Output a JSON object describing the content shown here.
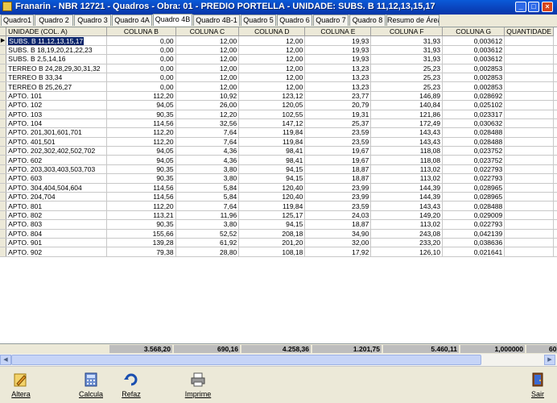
{
  "window": {
    "title": "Franarin - NBR 12721 - Quadros - Obra: 01 - PREDIO PORTELLA - UNIDADE: SUBS. B 11,12,13,15,17",
    "minimize": "_",
    "maximize": "□",
    "close": "×"
  },
  "tabs": [
    "Quadro1",
    "Quadro 2",
    "Quadro 3",
    "Quadro 4A",
    "Quadro 4B",
    "Quadro 4B-1",
    "Quadro 5",
    "Quadro 6",
    "Quadro 7",
    "Quadro 8",
    "Resumo de Áreas"
  ],
  "active_tab": "Quadro 4B",
  "grid": {
    "columns": [
      "UNIDADE (COL. A)",
      "COLUNA B",
      "COLUNA C",
      "COLUNA D",
      "COLUNA E",
      "COLUNA F",
      "COLUNA G",
      "QUANTIDADE"
    ],
    "rows": [
      [
        "SUBS. B 11,12,13,15,17",
        "0,00",
        "12,00",
        "12,00",
        "19,93",
        "31,93",
        "0,003612",
        ""
      ],
      [
        "SUBS. B 18,19,20,21,22,23",
        "0,00",
        "12,00",
        "12,00",
        "19,93",
        "31,93",
        "0,003612",
        ""
      ],
      [
        "SUBS. B 2,5,14,16",
        "0,00",
        "12,00",
        "12,00",
        "19,93",
        "31,93",
        "0,003612",
        ""
      ],
      [
        "TERREO B 24,28,29,30,31,32",
        "0,00",
        "12,00",
        "12,00",
        "13,23",
        "25,23",
        "0,002853",
        ""
      ],
      [
        "TERREO B 33,34",
        "0,00",
        "12,00",
        "12,00",
        "13,23",
        "25,23",
        "0,002853",
        ""
      ],
      [
        "TERREO B 25,26,27",
        "0,00",
        "12,00",
        "12,00",
        "13,23",
        "25,23",
        "0,002853",
        ""
      ],
      [
        "APTO. 101",
        "112,20",
        "10,92",
        "123,12",
        "23,77",
        "146,89",
        "0,028692",
        ""
      ],
      [
        "APTO. 102",
        "94,05",
        "26,00",
        "120,05",
        "20,79",
        "140,84",
        "0,025102",
        ""
      ],
      [
        "APTO. 103",
        "90,35",
        "12,20",
        "102,55",
        "19,31",
        "121,86",
        "0,023317",
        ""
      ],
      [
        "APTO. 104",
        "114,56",
        "32,56",
        "147,12",
        "25,37",
        "172,49",
        "0,030632",
        ""
      ],
      [
        "APTO. 201,301,601,701",
        "112,20",
        "7,64",
        "119,84",
        "23,59",
        "143,43",
        "0,028488",
        ""
      ],
      [
        "APTO. 401,501",
        "112,20",
        "7,64",
        "119,84",
        "23,59",
        "143,43",
        "0,028488",
        ""
      ],
      [
        "APTO. 202,302,402,502,702",
        "94,05",
        "4,36",
        "98,41",
        "19,67",
        "118,08",
        "0,023752",
        ""
      ],
      [
        "APTO. 602",
        "94,05",
        "4,36",
        "98,41",
        "19,67",
        "118,08",
        "0,023752",
        ""
      ],
      [
        "APTO. 203,303,403,503,703",
        "90,35",
        "3,80",
        "94,15",
        "18,87",
        "113,02",
        "0,022793",
        ""
      ],
      [
        "APTO. 603",
        "90,35",
        "3,80",
        "94,15",
        "18,87",
        "113,02",
        "0,022793",
        ""
      ],
      [
        "APTO. 304,404,504,604",
        "114,56",
        "5,84",
        "120,40",
        "23,99",
        "144,39",
        "0,028965",
        ""
      ],
      [
        "APTO. 204,704",
        "114,56",
        "5,84",
        "120,40",
        "23,99",
        "144,39",
        "0,028965",
        ""
      ],
      [
        "APTO. 801",
        "112,20",
        "7,64",
        "119,84",
        "23,59",
        "143,43",
        "0,028488",
        ""
      ],
      [
        "APTO. 802",
        "113,21",
        "11,96",
        "125,17",
        "24,03",
        "149,20",
        "0,029009",
        ""
      ],
      [
        "APTO. 803",
        "90,35",
        "3,80",
        "94,15",
        "18,87",
        "113,02",
        "0,022793",
        ""
      ],
      [
        "APTO. 804",
        "155,66",
        "52,52",
        "208,18",
        "34,90",
        "243,08",
        "0,042139",
        ""
      ],
      [
        "APTO. 901",
        "139,28",
        "61,92",
        "201,20",
        "32,00",
        "233,20",
        "0,038636",
        ""
      ],
      [
        "APTO. 902",
        "79,38",
        "28,80",
        "108,18",
        "17,92",
        "126,10",
        "0,021641",
        ""
      ]
    ],
    "selected_row": 0,
    "row_indicator": "▶"
  },
  "totals": [
    "3.568,20",
    "690,16",
    "4.258,36",
    "1.201,75",
    "5.460,11",
    "1,000000",
    "60"
  ],
  "scrollbar": {
    "left_arrow": "◀",
    "right_arrow": "▶"
  },
  "toolbar": {
    "buttons": [
      {
        "label": "Altera",
        "icon": "edit-icon"
      },
      {
        "label": "Calcula",
        "icon": "calculator-icon"
      },
      {
        "label": "Refaz",
        "icon": "refresh-icon"
      },
      {
        "label": "Imprime",
        "icon": "printer-icon"
      }
    ],
    "exit": {
      "label": "Sair",
      "icon": "exit-door-icon"
    }
  }
}
